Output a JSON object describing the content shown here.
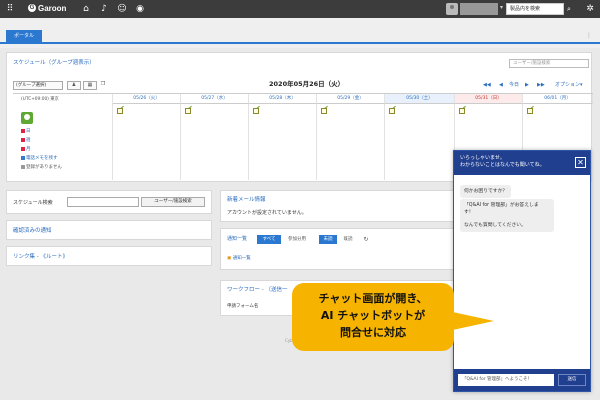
{
  "topbar": {
    "logo": "Garoon",
    "search_placeholder": "製品内を検索"
  },
  "portal": {
    "tab_label": "ポータル"
  },
  "schedule": {
    "title": "スケジュール（グループ週表示）",
    "user_search_placeholder": "ユーザー/施設検索",
    "group_select": "(グループ選択)",
    "date_title": "2020年05月26日（火）",
    "nav_today": "今日",
    "nav_prev": "◀",
    "nav_next": "▶",
    "nav_first": "◀◀",
    "nav_last": "▶▶",
    "options": "オプション▾",
    "timezone": "(UTC+09:00) 東京",
    "days": [
      "05/26（火）",
      "05/27（水）",
      "05/28（木）",
      "05/29（金）",
      "05/30（土）",
      "05/31（日）",
      "06/01（月）"
    ],
    "side_links": [
      "日",
      "週",
      "月",
      "電話メモを残す",
      "登録がありません"
    ]
  },
  "schedule_search": {
    "label": "スケジュール検索",
    "button": "ユーザー/施設検索"
  },
  "confirm_panel": {
    "title": "確認済みの通知"
  },
  "links_panel": {
    "title": "リンク集 - 《ルート》"
  },
  "mail_panel": {
    "title": "新着メール情報",
    "body": "アカウントが設定されていません。"
  },
  "notify_panel": {
    "title": "通知一覧",
    "tab_all": "すべて",
    "tab_participate": "参加分用",
    "tab_unread": "未読",
    "tab_read": "既読",
    "item": "通知一覧"
  },
  "workflow_panel": {
    "title": "ワークフロー - （送信一",
    "row": "申請フォーム名"
  },
  "footer": {
    "text": "Cyb"
  },
  "chat": {
    "header_line1": "いらっしゃいませ。",
    "header_line2": "わからないことはなんでも聞いてね。",
    "msg1": "何かお困りですか？",
    "msg2_line1": "「Q&AI for 管理部」がお答えしま",
    "msg2_line2": "す！",
    "msg3": "なんでも質問してください。",
    "input_value": "「Q&AI for 管理部」へようこそ！",
    "send_label": "送信"
  },
  "callout": {
    "line1": "チャット画面が開き、",
    "line2": "AI チャットボットが",
    "line3": "問合せに対応"
  }
}
